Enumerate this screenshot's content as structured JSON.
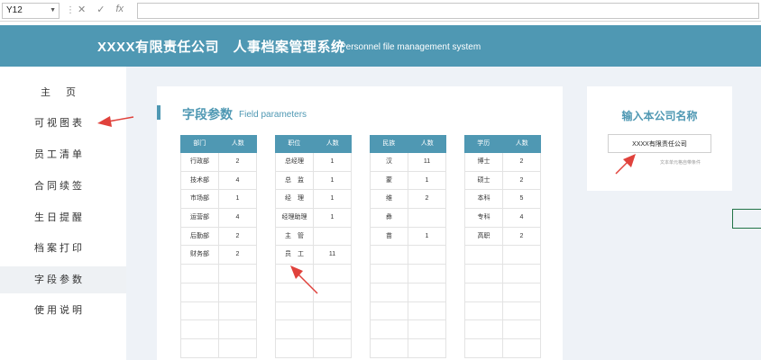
{
  "formula_bar": {
    "name_box": "Y12",
    "fx_label": "fx"
  },
  "header": {
    "title": "XXXX有限责任公司　人事档案管理系统",
    "subtitle": "Personnel file management system"
  },
  "sidebar": {
    "items": [
      {
        "label": "主　页"
      },
      {
        "label": "可视图表"
      },
      {
        "label": "员工清单"
      },
      {
        "label": "合同续签"
      },
      {
        "label": "生日提醒"
      },
      {
        "label": "档案打印"
      },
      {
        "label": "字段参数",
        "active": true
      },
      {
        "label": "使用说明"
      }
    ]
  },
  "main": {
    "title": "字段参数",
    "subtitle": "Field parameters",
    "tables": [
      {
        "headers": [
          "部门",
          "人数"
        ],
        "rows": [
          [
            "行政部",
            "2"
          ],
          [
            "技术部",
            "4"
          ],
          [
            "市场部",
            "1"
          ],
          [
            "运营部",
            "4"
          ],
          [
            "后勤部",
            "2"
          ],
          [
            "财务部",
            "2"
          ]
        ]
      },
      {
        "headers": [
          "职位",
          "人数"
        ],
        "rows": [
          [
            "总经理",
            "1"
          ],
          [
            "总　监",
            "1"
          ],
          [
            "经　理",
            "1"
          ],
          [
            "经理助理",
            "1"
          ],
          [
            "主　管",
            ""
          ],
          [
            "员　工",
            "11"
          ]
        ]
      },
      {
        "headers": [
          "民族",
          "人数"
        ],
        "rows": [
          [
            "汉",
            "11"
          ],
          [
            "蒙",
            "1"
          ],
          [
            "维",
            "2"
          ],
          [
            "彝",
            ""
          ],
          [
            "苗",
            "1"
          ]
        ]
      },
      {
        "headers": [
          "学历",
          "人数"
        ],
        "rows": [
          [
            "博士",
            "2"
          ],
          [
            "硕士",
            "2"
          ],
          [
            "本科",
            "5"
          ],
          [
            "专科",
            "4"
          ],
          [
            "高职",
            "2"
          ]
        ]
      }
    ]
  },
  "company": {
    "heading": "输入本公司名称",
    "value": "XXXX有限责任公司",
    "note": "文本单元格自带条件"
  },
  "colors": {
    "accent": "#4f98b3",
    "annotation_arrow": "#e0423c",
    "selection": "#217346"
  }
}
